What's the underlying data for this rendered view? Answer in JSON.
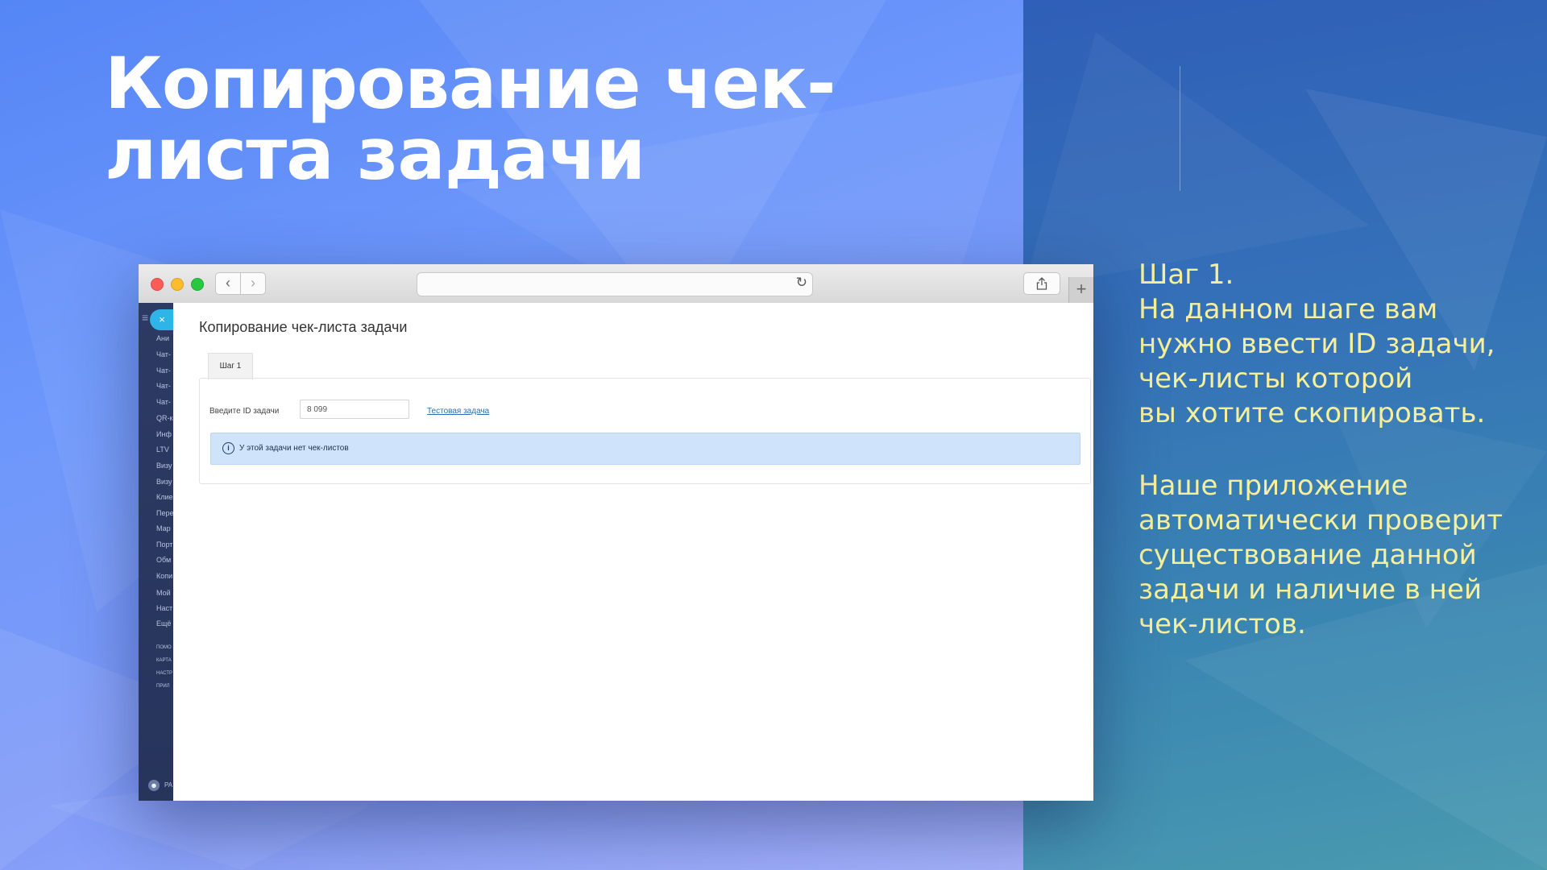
{
  "slide": {
    "title": "Копирование чек-листа задачи",
    "step_heading": "Шаг 1.",
    "step_paragraph1": "На данном шаге вам\nнужно ввести ID задачи,\nчек-листы которой\nвы хотите скопировать.",
    "step_paragraph2": "Наше приложение\nавтоматически проверит\nсуществование данной\nзадачи и наличие в ней\nчек-листов."
  },
  "browser": {
    "url": "",
    "sidebar": {
      "items": [
        "Ани",
        "Чат-",
        "Чат-",
        "Чат-",
        "Чат-",
        "QR-к",
        "Инф",
        "LTV",
        "Визу",
        "Визу",
        "Клие",
        "Пере",
        "Мар",
        "Порт",
        "Обм",
        "Копи",
        "Мой",
        "Наст",
        "Ещё",
        "ПОМО",
        "КАРТА",
        "НАСТР",
        "ПРИЛ"
      ],
      "user_label": "РА"
    },
    "page": {
      "title": "Копирование чек-листа задачи",
      "tab_label": "Шаг 1",
      "field_label": "Введите ID задачи",
      "id_value": "8 099",
      "link_text": "Тестовая задача",
      "alert_text": "У этой задачи нет чек-листов"
    }
  },
  "colors": {
    "step_text": "#f6ef9c",
    "alert_bg": "#cfe4fb",
    "link": "#2b6fb4"
  },
  "icons": {
    "back": "chevron-left-icon",
    "forward": "chevron-right-icon",
    "reload": "reload-icon",
    "share": "share-icon",
    "new_tab": "plus-icon",
    "info": "info-icon"
  }
}
